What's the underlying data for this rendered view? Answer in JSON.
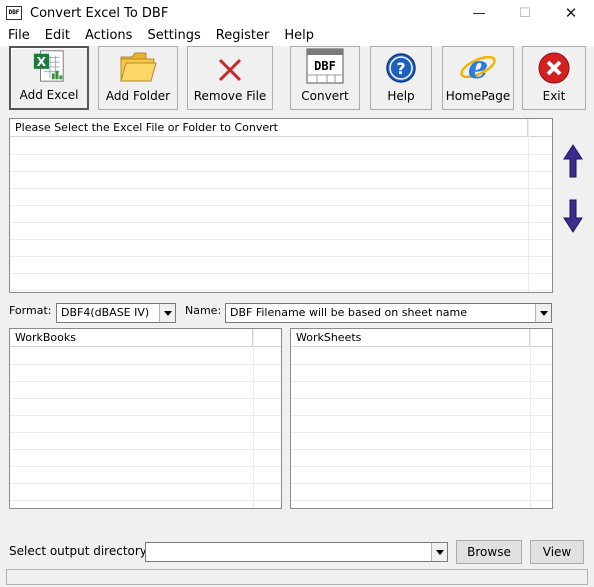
{
  "window": {
    "title": "Convert Excel To DBF",
    "app_icon_text": "DBF",
    "minimize_glyph": "—",
    "maximize_glyph": "☐",
    "close_glyph": "✕"
  },
  "menu": [
    "File",
    "Edit",
    "Actions",
    "Settings",
    "Register",
    "Help"
  ],
  "toolbar": {
    "add_excel": "Add Excel",
    "add_folder": "Add Folder",
    "remove_file": "Remove File",
    "convert": "Convert",
    "convert_icon_text": "DBF",
    "help": "Help",
    "homepage": "HomePage",
    "exit": "Exit"
  },
  "file_list": {
    "header": "Please Select the Excel File or Folder to Convert"
  },
  "options": {
    "format_label": "Format:",
    "format_value": "DBF4(dBASE IV)",
    "name_label": "Name:",
    "name_value": "DBF Filename will be based on sheet name"
  },
  "workbooks": {
    "header": "WorkBooks"
  },
  "worksheets": {
    "header": "WorkSheets"
  },
  "output": {
    "label": "Select  output directory:",
    "value": "",
    "browse": "Browse",
    "view": "View"
  },
  "colors": {
    "arrow": "#3b2d8c",
    "exit_red": "#d42020",
    "help_blue": "#1f5fbf",
    "ie_blue": "#2a7be0",
    "folder_yellow": "#f5c842",
    "remove_red": "#c62828"
  },
  "icons": {
    "add_excel": "excel-file-icon",
    "add_folder": "folder-icon",
    "remove_file": "remove-x-icon",
    "convert": "dbf-table-icon",
    "help": "help-question-icon",
    "homepage": "internet-explorer-icon",
    "exit": "exit-x-icon",
    "move_up": "arrow-up-icon",
    "move_down": "arrow-down-icon"
  }
}
